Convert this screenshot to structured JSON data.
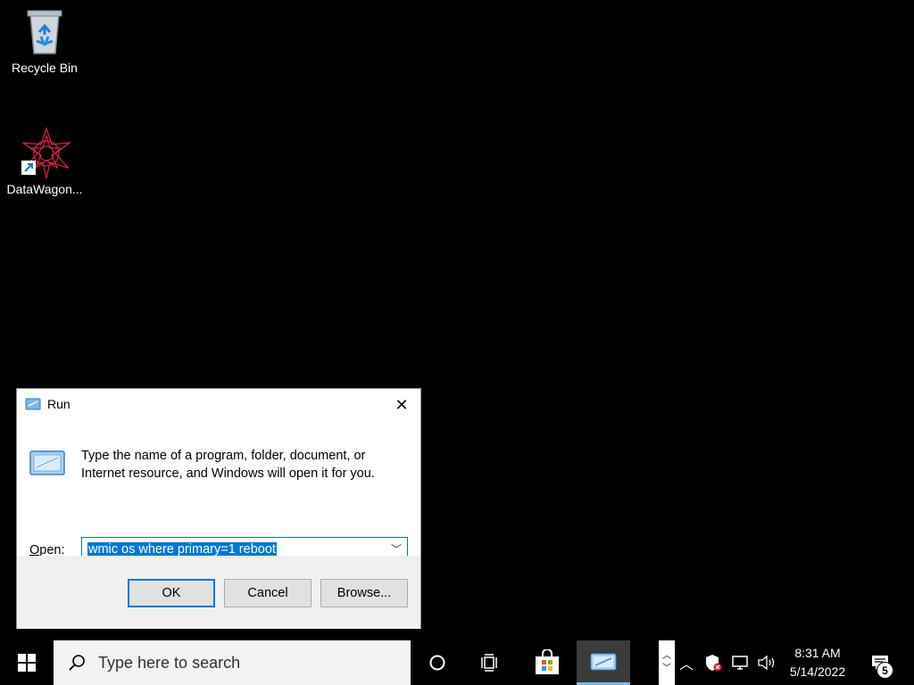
{
  "desktop": {
    "icons": [
      {
        "label": "Recycle Bin",
        "icon": "recycle-bin-icon"
      },
      {
        "label": "DataWagon...",
        "icon": "datawagon-app-icon"
      }
    ]
  },
  "run_dialog": {
    "title": "Run",
    "description_line1": "Type the name of a program, folder, document, or",
    "description_line2": "Internet resource, and Windows will open it for you.",
    "open_label_prefix": "O",
    "open_label_rest": "pen:",
    "open_value": "wmic os where primary=1 reboot",
    "buttons": {
      "ok": "OK",
      "cancel": "Cancel",
      "browse": "Browse..."
    }
  },
  "taskbar": {
    "search_placeholder": "Type here to search",
    "clock_time": "8:31 AM",
    "clock_date": "5/14/2022",
    "notification_count": "5"
  },
  "colors": {
    "desktop_bg": "#000000",
    "accent": "#0078d7",
    "dialog_footer": "#f0f0f0"
  }
}
